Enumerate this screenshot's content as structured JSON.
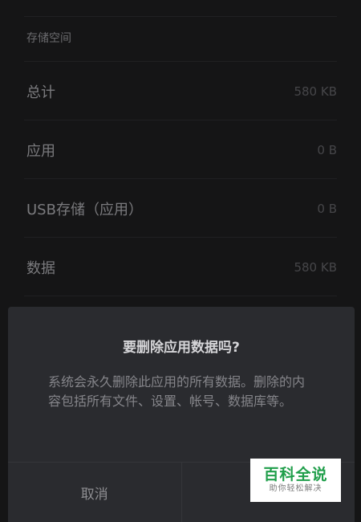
{
  "storage": {
    "header": "存储空间",
    "rows": [
      {
        "label": "总计",
        "value": "580 KB"
      },
      {
        "label": "应用",
        "value": "0 B"
      },
      {
        "label": "USB存储（应用）",
        "value": "0 B"
      },
      {
        "label": "数据",
        "value": "580 KB"
      }
    ]
  },
  "dialog": {
    "title": "要删除应用数据吗?",
    "message": "系统会永久删除此应用的所有数据。删除的内容包括所有文件、设置、帐号、数据库等。",
    "cancel_label": "取消",
    "confirm_label": ""
  },
  "watermark": {
    "title": "百科全说",
    "subtitle": "助你轻松解决"
  }
}
